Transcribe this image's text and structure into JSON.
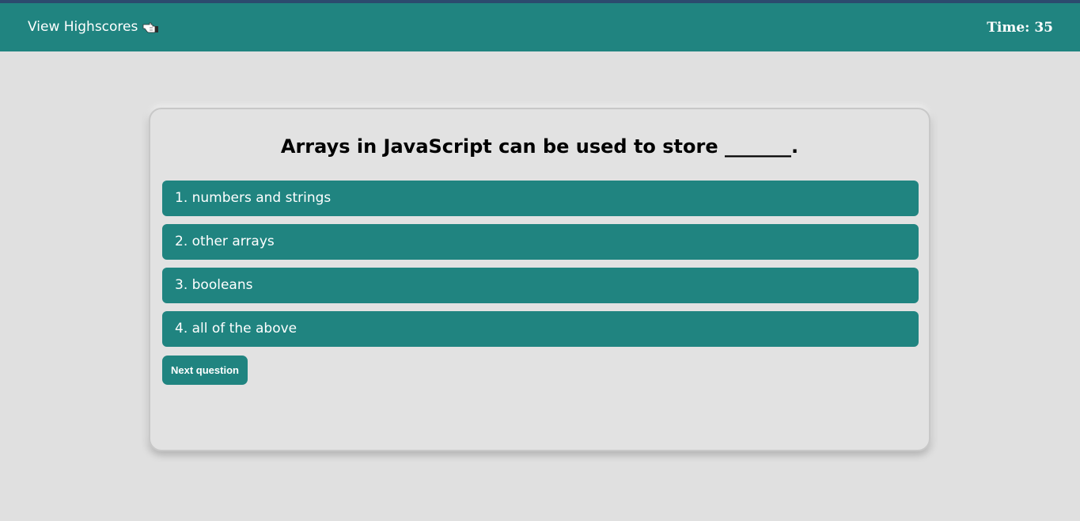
{
  "header": {
    "highscores_label": "View Highscores",
    "highscores_icon": "pointing-hand-icon",
    "timer_label": "Time:",
    "timer_value": "35"
  },
  "quiz": {
    "question": "Arrays in JavaScript can be used to store _______.",
    "answers": [
      {
        "label": "1. numbers and strings"
      },
      {
        "label": "2. other arrays"
      },
      {
        "label": "3. booleans"
      },
      {
        "label": "4. all of the above"
      }
    ],
    "next_label": "Next question"
  },
  "colors": {
    "accent": "#208480",
    "background": "#e0e0e0",
    "top_strip": "#2c4a6e"
  }
}
